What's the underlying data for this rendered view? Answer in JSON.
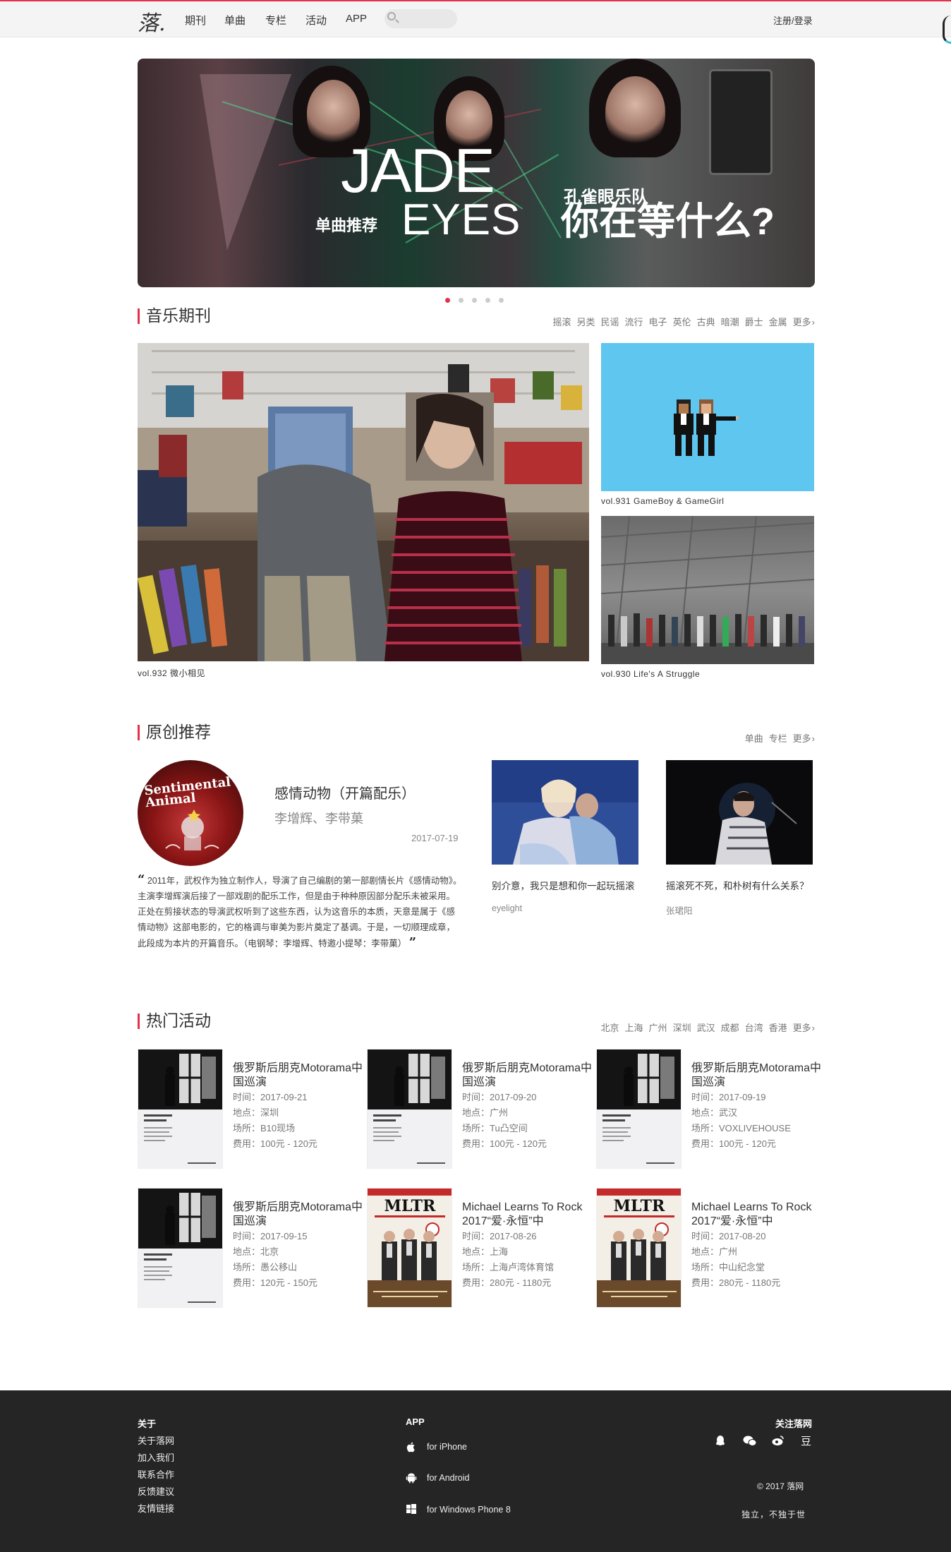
{
  "nav": {
    "logo": "落.",
    "items": [
      "期刊",
      "单曲",
      "专栏",
      "活动",
      "APP"
    ],
    "search_placeholder": "",
    "login": "注册/登录"
  },
  "banner": {
    "title_big": "JADE",
    "title_big2": "EYES",
    "tag": "单曲推荐",
    "band": "孔雀眼乐队",
    "song": "你在等什么?",
    "slides": 5,
    "active_slide": 1
  },
  "journal": {
    "title": "音乐期刊",
    "tags": [
      "摇滚",
      "另类",
      "民谣",
      "流行",
      "电子",
      "英伦",
      "古典",
      "暗潮",
      "爵士",
      "金属",
      "更多"
    ],
    "main": {
      "caption": "vol.932 微小相见"
    },
    "side": [
      {
        "caption": "vol.931 GameBoy & GameGirl"
      },
      {
        "caption": "vol.930 Life's A Struggle"
      }
    ]
  },
  "original": {
    "title": "原创推荐",
    "links": [
      "单曲",
      "专栏",
      "更多"
    ],
    "disc_text": "Sentimental Animal",
    "song": "感情动物（开篇配乐）",
    "artist": "李增辉、李带菓",
    "date": "2017-07-19",
    "quote": "2011年，武权作为独立制作人，导演了自己编剧的第一部剧情长片《感情动物》。主演李增辉演后接了一部戏剧的配乐工作，但是由于种种原因部分配乐未被采用。正处在剪接状态的导演武权听到了这些东西，认为这音乐的本质，天意是属于《感情动物》这部电影的，它的格调与审美为影片奠定了基调。于是，一切顺理成章，此段成为本片的开篇音乐。（电钢琴：李增辉、特邀小提琴：李带菓）",
    "cards": [
      {
        "title": "别介意，我只是想和你一起玩摇滚",
        "author": "eyelight"
      },
      {
        "title": "摇滚死不死，和朴树有什么关系？",
        "author": "张珺阳"
      }
    ]
  },
  "events": {
    "title": "热门活动",
    "cities": [
      "北京",
      "上海",
      "广州",
      "深圳",
      "武汉",
      "成都",
      "台湾",
      "香港",
      "更多"
    ],
    "items": [
      {
        "poster": "dark",
        "title": "俄罗斯后朋克Motorama中国巡演",
        "time": "时间：2017-09-21",
        "place": "地点：深圳",
        "venue": "场所：B10现场",
        "fee": "费用：100元 - 120元"
      },
      {
        "poster": "dark",
        "title": "俄罗斯后朋克Motorama中国巡演",
        "time": "时间：2017-09-20",
        "place": "地点：广州",
        "venue": "场所：Tu凸空间",
        "fee": "费用：100元 - 120元"
      },
      {
        "poster": "dark",
        "title": "俄罗斯后朋克Motorama中国巡演",
        "time": "时间：2017-09-19",
        "place": "地点：武汉",
        "venue": "场所：VOXLIVEHOUSE",
        "fee": "费用：100元 - 120元"
      },
      {
        "poster": "dark",
        "title": "俄罗斯后朋克Motorama中国巡演",
        "time": "时间：2017-09-15",
        "place": "地点：北京",
        "venue": "场所：愚公移山",
        "fee": "费用：120元 - 150元"
      },
      {
        "poster": "mltr",
        "title": "Michael Learns To Rock 2017“爱·永恒”中",
        "time": "时间：2017-08-26",
        "place": "地点：上海",
        "venue": "场所：上海卢湾体育馆",
        "fee": "费用：280元 - 1180元"
      },
      {
        "poster": "mltr",
        "title": "Michael Learns To Rock 2017“爱·永恒”中",
        "time": "时间：2017-08-20",
        "place": "地点：广州",
        "venue": "场所：中山纪念堂",
        "fee": "费用：280元 - 1180元"
      }
    ],
    "mltr_logo": "MLTR"
  },
  "footer": {
    "about": {
      "title": "关于",
      "links": [
        "关于落网",
        "加入我们",
        "联系合作",
        "反馈建议",
        "友情链接"
      ]
    },
    "app": {
      "title": "APP",
      "links": [
        "for iPhone",
        "for Android",
        "for Windows Phone 8"
      ]
    },
    "follow": {
      "title": "关注落网",
      "icons": [
        "qq-icon",
        "wechat-icon",
        "weibo-icon",
        "douban-icon"
      ]
    },
    "copyright": "© 2017 落网",
    "slogan": "独立，不独于世"
  }
}
